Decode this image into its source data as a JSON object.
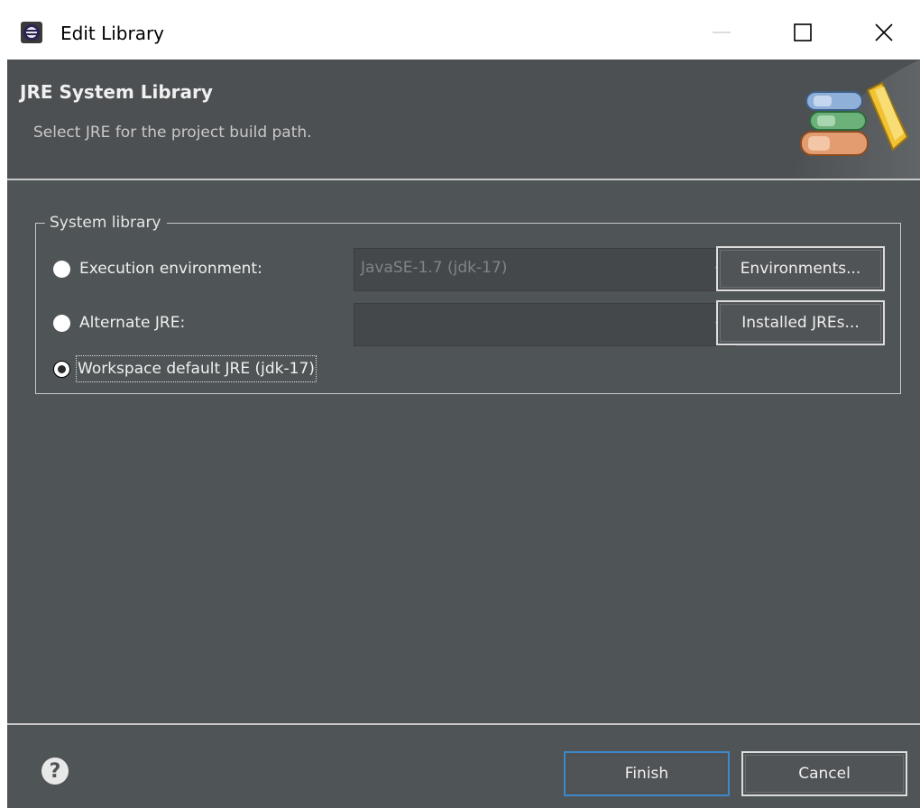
{
  "window": {
    "title": "Edit Library",
    "controls": [
      "minimize-icon",
      "maximize-icon",
      "close-icon"
    ]
  },
  "banner": {
    "title": "JRE System Library",
    "description": "Select JRE for the project build path."
  },
  "group": {
    "legend": "System library",
    "options": [
      {
        "label": "Execution environment:",
        "mnemonic_index": 1,
        "selected": false,
        "combo_value": "JavaSE-1.7 (jdk-17)",
        "button_label": "Environments...",
        "button_mnemonic": "o"
      },
      {
        "label": "Alternate JRE:",
        "selected": false,
        "combo_value": "",
        "button_label": "Installed JREs...",
        "button_mnemonic": "I"
      },
      {
        "label": "Workspace default JRE (jdk-17)",
        "selected": true
      }
    ]
  },
  "footer": {
    "help_icon": "help-icon",
    "finish_label": "Finish",
    "cancel_label": "Cancel"
  },
  "colors": {
    "dialog_bg": "#4f5456",
    "banner_bg": "#4c5052",
    "text": "#f0f0f0",
    "default_button_border": "#3c86c9"
  }
}
